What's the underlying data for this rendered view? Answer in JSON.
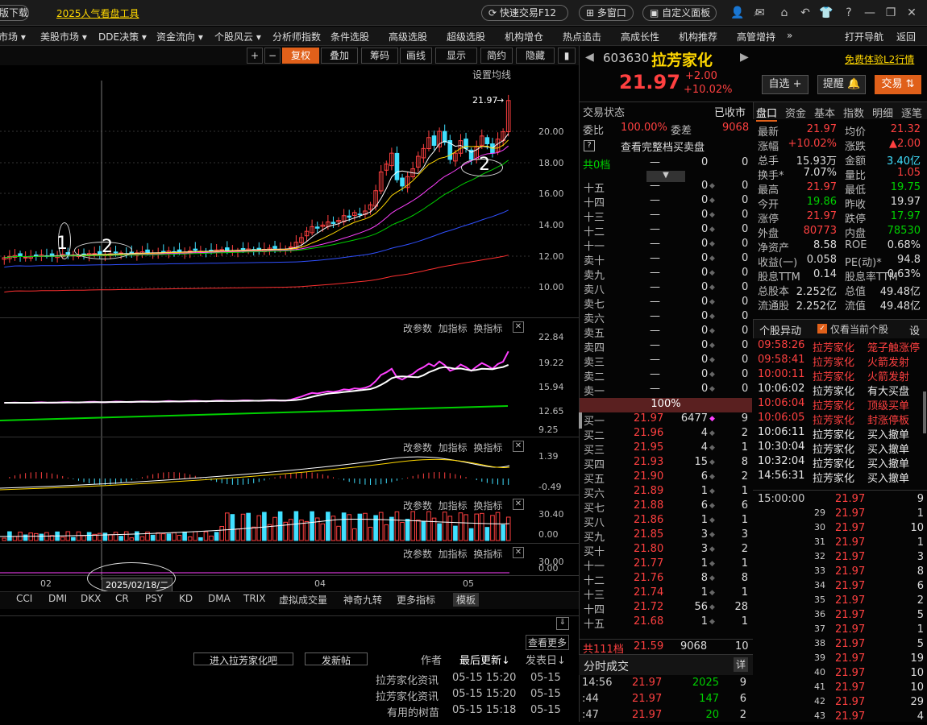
{
  "topbar": {
    "download": "版下载",
    "popular_tools": "2025人气看盘工具",
    "quick_trade": "快速交易F12",
    "multi_window": "多窗口",
    "custom_panel": "自定义面板"
  },
  "menu": [
    "市场 ▾",
    "美股市场 ▾",
    "DDE决策 ▾",
    "资金流向 ▾",
    "个股风云 ▾",
    "分析师指数",
    "条件选股",
    "高级选股",
    "超级选股",
    "机构增仓",
    "热点追击",
    "高成长性",
    "机构推荐",
    "高管增持",
    "»",
    "打开导航",
    "返回"
  ],
  "chart_tools": {
    "plus": "+",
    "minus": "−",
    "restore": "复权",
    "overlay": "叠加",
    "chips": "筹码",
    "draw": "画线",
    "display": "显示",
    "simple": "简约",
    "hide": "隐藏",
    "set_ma": "设置均线"
  },
  "chart_data": {
    "type": "candlestick",
    "y_ticks": [
      20.0,
      18.0,
      16.0,
      14.0,
      12.0,
      10.0
    ],
    "last_price_label": "21.97",
    "x_labels": [
      "02",
      "04",
      "05"
    ],
    "crosshair_date": "2025/02/18/二",
    "annotations": [
      "1",
      "2",
      "2"
    ],
    "panel2_ticks": [
      "22.84",
      "19.22",
      "15.94",
      "12.65",
      "9.25"
    ],
    "panel3_ticks": [
      "1.39",
      "-0.49"
    ],
    "panel4_ticks": [
      "30.40",
      "0.00"
    ],
    "panel5_ticks": [
      "30.00",
      "0.00"
    ]
  },
  "panel_tools": {
    "params": "改参数",
    "add": "加指标",
    "switch": "换指标",
    "close": "✕"
  },
  "indicators": [
    "CCI",
    "DMI",
    "DKX",
    "CR",
    "PSY",
    "KD",
    "DMA",
    "TRIX",
    "虚拟成交量",
    "神奇九转",
    "更多指标",
    "模板"
  ],
  "forum": {
    "enter": "进入拉芳家化吧",
    "post": "发新帖",
    "more": "查看更多",
    "author": "作者",
    "latest": "最后更新↓",
    "post_date": "发表日↓",
    "rows": [
      [
        "拉芳家化资讯",
        "05-15 15:20",
        "05-15"
      ],
      [
        "拉芳家化资讯",
        "05-15 15:20",
        "05-15"
      ],
      [
        "有用的树苗",
        "05-15 15:18",
        "05-15"
      ]
    ]
  },
  "stock": {
    "code": "603630",
    "name": "拉芳家化",
    "price": "21.97",
    "change": "+2.00",
    "change_pct": "+10.02%",
    "trial": "免费体验L2行情",
    "watch": "自选 +",
    "alert": "提醒",
    "trade": "交易",
    "trade_status_label": "交易状态",
    "trade_status": "已收市",
    "commission_ratio_label": "委比",
    "commission_ratio": "100.00%",
    "commission_diff_label": "委差",
    "commission_diff": "9068",
    "full_book": "查看完整档买卖盘",
    "zero_level": "共0档"
  },
  "tabs": [
    "盘口",
    "资金",
    "基本",
    "指数",
    "明细",
    "逐笔"
  ],
  "sell_levels": [
    [
      "十五",
      "—",
      "0",
      "0"
    ],
    [
      "十四",
      "—",
      "0",
      "0"
    ],
    [
      "十三",
      "—",
      "0",
      "0"
    ],
    [
      "十二",
      "—",
      "0",
      "0"
    ],
    [
      "十一",
      "—",
      "0",
      "0"
    ],
    [
      "卖十",
      "—",
      "0",
      "0"
    ],
    [
      "卖九",
      "—",
      "0",
      "0"
    ],
    [
      "卖八",
      "—",
      "0",
      "0"
    ],
    [
      "卖七",
      "—",
      "0",
      "0"
    ],
    [
      "卖六",
      "—",
      "0",
      "0"
    ],
    [
      "卖五",
      "—",
      "0",
      "0"
    ],
    [
      "卖四",
      "—",
      "0",
      "0"
    ],
    [
      "卖三",
      "—",
      "0",
      "0"
    ],
    [
      "卖二",
      "—",
      "0",
      "0"
    ],
    [
      "卖一",
      "—",
      "0",
      "0"
    ]
  ],
  "ratio": "100%",
  "buy_levels": [
    [
      "买一",
      "21.97",
      "6477",
      "9"
    ],
    [
      "买二",
      "21.96",
      "4",
      "2"
    ],
    [
      "买三",
      "21.95",
      "4",
      "1"
    ],
    [
      "买四",
      "21.93",
      "15",
      "8"
    ],
    [
      "买五",
      "21.90",
      "6",
      "2"
    ],
    [
      "买六",
      "21.89",
      "1",
      "1"
    ],
    [
      "买七",
      "21.88",
      "6",
      "6"
    ],
    [
      "买八",
      "21.86",
      "1",
      "1"
    ],
    [
      "买九",
      "21.85",
      "3",
      "3"
    ],
    [
      "买十",
      "21.80",
      "3",
      "2"
    ],
    [
      "十一",
      "21.77",
      "1",
      "1"
    ],
    [
      "十二",
      "21.76",
      "8",
      "8"
    ],
    [
      "十三",
      "21.74",
      "1",
      "1"
    ],
    [
      "十四",
      "21.72",
      "56",
      "28"
    ],
    [
      "十五",
      "21.68",
      "1",
      "1"
    ]
  ],
  "total_levels": [
    "共111档",
    "21.59",
    "9068",
    "10"
  ],
  "stats": [
    [
      "最新",
      "21.97",
      "均价",
      "21.32"
    ],
    [
      "涨幅",
      "+10.02%",
      "涨跌",
      "▲2.00"
    ],
    [
      "总手",
      "15.93万",
      "金额",
      "3.40亿"
    ],
    [
      "换手*",
      "7.07%",
      "量比",
      "1.05"
    ],
    [
      "最高",
      "21.97",
      "最低",
      "19.75"
    ],
    [
      "今开",
      "19.86",
      "昨收",
      "19.97"
    ],
    [
      "涨停",
      "21.97",
      "跌停",
      "17.97"
    ],
    [
      "外盘",
      "80773",
      "内盘",
      "78530"
    ],
    [
      "净资产",
      "8.58",
      "ROE",
      "0.68%"
    ],
    [
      "收益(一)",
      "0.058",
      "PE(动)*",
      "94.8"
    ],
    [
      "股息TTM",
      "0.14",
      "股息率TTM",
      "0.63%"
    ],
    [
      "总股本",
      "2.252亿",
      "总值",
      "49.48亿"
    ],
    [
      "流通股",
      "2.252亿",
      "流值",
      "49.48亿"
    ]
  ],
  "events_header": {
    "title": "个股异动",
    "only_current": "仅看当前个股",
    "settings": "设"
  },
  "events": [
    [
      "09:58:26",
      "拉芳家化",
      "笼子触涨停"
    ],
    [
      "09:58:41",
      "拉芳家化",
      "火箭发射"
    ],
    [
      "10:00:11",
      "拉芳家化",
      "火箭发射"
    ],
    [
      "10:06:02",
      "拉芳家化",
      "有大买盘"
    ],
    [
      "10:06:04",
      "拉芳家化",
      "顶级买单"
    ],
    [
      "10:06:05",
      "拉芳家化",
      "封涨停板"
    ],
    [
      "10:06:11",
      "拉芳家化",
      "买入撤单"
    ],
    [
      "10:30:04",
      "拉芳家化",
      "买入撤单"
    ],
    [
      "10:32:04",
      "拉芳家化",
      "买入撤单"
    ],
    [
      "14:56:31",
      "拉芳家化",
      "买入撤单"
    ]
  ],
  "ticks": [
    [
      "15:00:00",
      "21.97",
      "9"
    ],
    [
      "29",
      "21.97",
      "1"
    ],
    [
      "30",
      "21.97",
      "10"
    ],
    [
      "31",
      "21.97",
      "1"
    ],
    [
      "32",
      "21.97",
      "3"
    ],
    [
      "33",
      "21.97",
      "8"
    ],
    [
      "34",
      "21.97",
      "6"
    ],
    [
      "35",
      "21.97",
      "2"
    ],
    [
      "36",
      "21.97",
      "5"
    ],
    [
      "37",
      "21.97",
      "1"
    ],
    [
      "38",
      "21.97",
      "5"
    ],
    [
      "39",
      "21.97",
      "19"
    ],
    [
      "40",
      "21.97",
      "10"
    ],
    [
      "41",
      "21.97",
      "10"
    ],
    [
      "42",
      "21.97",
      "29"
    ],
    [
      "43",
      "21.97",
      "4"
    ]
  ],
  "tape_title": "分时成交",
  "tape_detail": "详",
  "tape": [
    [
      "14:56",
      "21.97",
      "2025",
      "9"
    ],
    [
      ":44",
      "21.97",
      "147",
      "6"
    ],
    [
      ":47",
      "21.97",
      "20",
      "2"
    ]
  ]
}
